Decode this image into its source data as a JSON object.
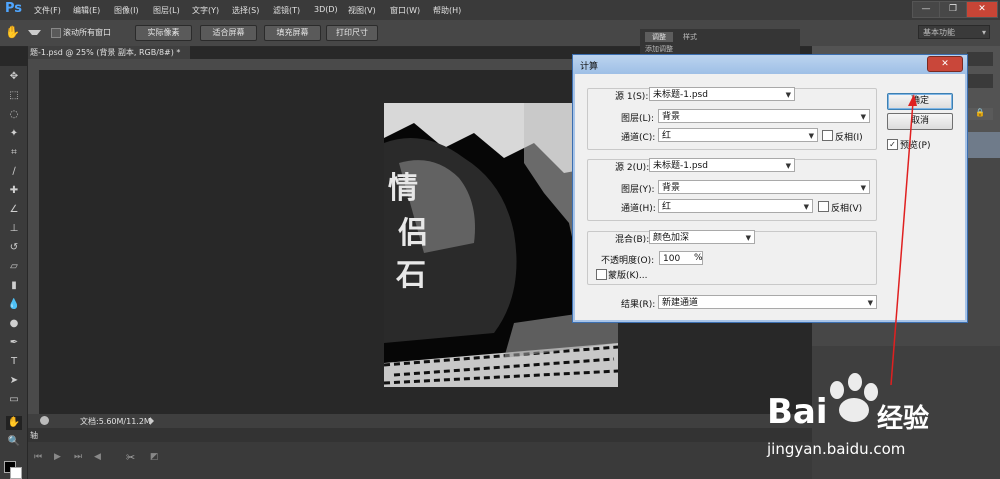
{
  "app": {
    "logo": "Ps"
  },
  "menubar": {
    "items": [
      "文件(F)",
      "编辑(E)",
      "图像(I)",
      "图层(L)",
      "文字(Y)",
      "选择(S)",
      "滤镜(T)",
      "3D(D)",
      "视图(V)",
      "窗口(W)",
      "帮助(H)"
    ],
    "window_buttons": {
      "minimize": "—",
      "restore": "❐",
      "close": "✕"
    }
  },
  "options_bar": {
    "scroll_all_label": "滚动所有窗口",
    "buttons": [
      "实际像素",
      "适合屏幕",
      "填充屏幕",
      "打印尺寸"
    ],
    "workspace": "基本功能"
  },
  "document": {
    "tab_label": "题-1.psd @ 25% (背景 副本, RGB/8#) *",
    "tab_close": "×",
    "status": "文档:5.60M/11.2M",
    "image_text": "情侣石"
  },
  "timeline": {
    "tab_label": "轴"
  },
  "panels": {
    "tabs": [
      "调整",
      "样式"
    ],
    "subtitle": "添加调整"
  },
  "dialog": {
    "title": "计算",
    "close": "✕",
    "source1": {
      "label": "源 1(S):",
      "file": "未标题-1.psd",
      "layer_label": "图层(L):",
      "layer": "背景",
      "channel_label": "通道(C):",
      "channel": "红",
      "invert_label": "反相(I)",
      "invert": false
    },
    "source2": {
      "label": "源 2(U):",
      "file": "未标题-1.psd",
      "layer_label": "图层(Y):",
      "layer": "背景",
      "channel_label": "通道(H):",
      "channel": "红",
      "invert_label": "反相(V)",
      "invert": false
    },
    "blend": {
      "label": "混合(B):",
      "mode": "颜色加深",
      "opacity_label": "不透明度(O):",
      "opacity": "100",
      "opacity_unit": "%",
      "mask_label": "蒙版(K)...",
      "mask": false
    },
    "result": {
      "label": "结果(R):",
      "value": "新建通道"
    },
    "ok": "确定",
    "cancel": "取消",
    "preview_label": "预览(P)",
    "preview": true
  },
  "watermark": {
    "brand": "Bai",
    "brand2": "经验",
    "url": "jingyan.baidu.com"
  },
  "colors": {
    "annotation_arrow": "#e02020",
    "ps_blue": "#4fa6ff",
    "dialog_title": "#9ebfe6"
  }
}
